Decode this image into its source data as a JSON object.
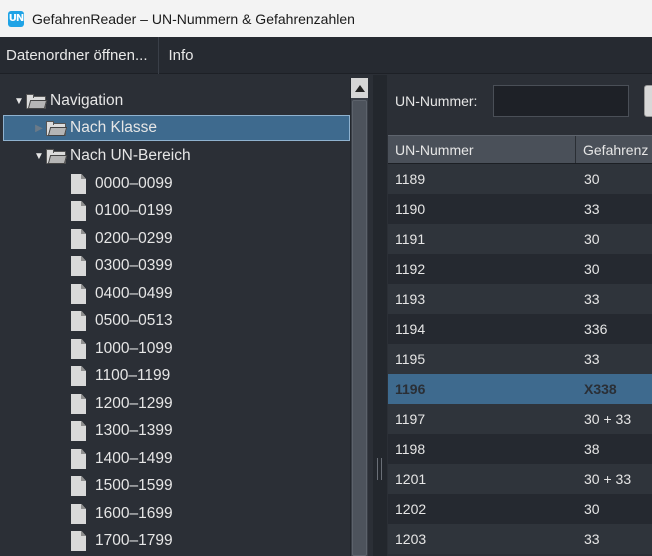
{
  "window": {
    "app_icon_text": "UN",
    "title": "GefahrenReader – UN-Nummern & Gefahrenzahlen"
  },
  "menu": {
    "items": [
      "Datenordner öffnen...",
      "Info"
    ]
  },
  "tree": {
    "root": "Navigation",
    "nodes": [
      {
        "label": "Nach Klasse",
        "selected": true
      },
      {
        "label": "Nach UN-Bereich",
        "selected": false
      }
    ],
    "ranges": [
      "0000–0099",
      "0100–0199",
      "0200–0299",
      "0300–0399",
      "0400–0499",
      "0500–0513",
      "1000–1099",
      "1100–1199",
      "1200–1299",
      "1300–1399",
      "1400–1499",
      "1500–1599",
      "1600–1699",
      "1700–1799"
    ]
  },
  "search": {
    "label": "UN-Nummer:",
    "value": ""
  },
  "table": {
    "columns": [
      "UN-Nummer",
      "Gefahrenz"
    ],
    "rows": [
      {
        "un": "1189",
        "gz": "30"
      },
      {
        "un": "1190",
        "gz": "33"
      },
      {
        "un": "1191",
        "gz": "30"
      },
      {
        "un": "1192",
        "gz": "30"
      },
      {
        "un": "1193",
        "gz": "33"
      },
      {
        "un": "1194",
        "gz": "336"
      },
      {
        "un": "1195",
        "gz": "33"
      },
      {
        "un": "1196",
        "gz": "X338",
        "selected": true
      },
      {
        "un": "1197",
        "gz": "30 + 33"
      },
      {
        "un": "1198",
        "gz": "38"
      },
      {
        "un": "1201",
        "gz": "30 + 33"
      },
      {
        "un": "1202",
        "gz": "30"
      },
      {
        "un": "1203",
        "gz": "33"
      }
    ]
  },
  "colors": {
    "selection": "#3e6a8e",
    "background": "#2b2f36"
  }
}
